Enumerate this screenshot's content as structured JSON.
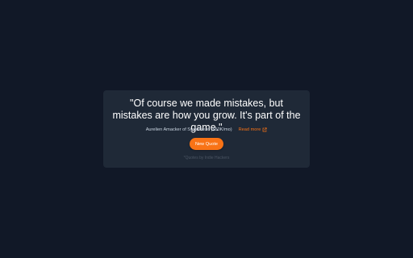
{
  "quote_card": {
    "quote": "\"Of course we made mistakes, but mistakes are how you grow. It's part of the game.\"",
    "author": "Aurelien Amacker of Systeme.io ($50K/mo)",
    "read_more_label": "Read more",
    "read_more_icon": "external-link-icon",
    "button_label": "New Quote",
    "credit": "*Quotes by Indie Hackers"
  },
  "colors": {
    "background": "#111827",
    "card": "#1f2937",
    "accent": "#f97316",
    "text": "#ffffff",
    "muted": "#cbd5e1",
    "credit": "#4b5563"
  }
}
